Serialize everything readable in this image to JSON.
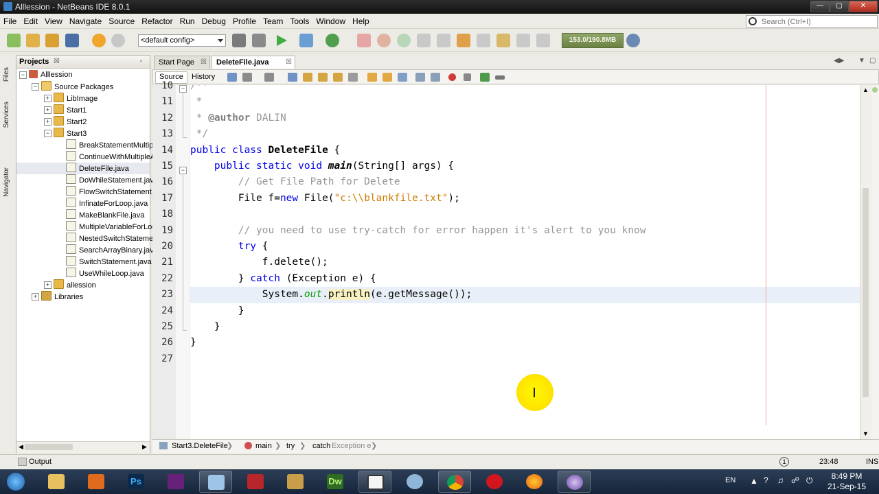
{
  "window": {
    "title": "Alllession - NetBeans IDE 8.0.1"
  },
  "menu": [
    "File",
    "Edit",
    "View",
    "Navigate",
    "Source",
    "Refactor",
    "Run",
    "Debug",
    "Profile",
    "Team",
    "Tools",
    "Window",
    "Help"
  ],
  "search": {
    "placeholder": "Search (Ctrl+I)"
  },
  "toolbar": {
    "config": "<default config>",
    "memory": "153.0/190.8MB"
  },
  "side_tabs": [
    "Files",
    "Services",
    "Navigator"
  ],
  "projects": {
    "title": "Projects",
    "tree": [
      {
        "label": "Alllession",
        "level": 0,
        "type": "proj",
        "exp": "-"
      },
      {
        "label": "Source Packages",
        "level": 1,
        "type": "pkg",
        "exp": "-"
      },
      {
        "label": "LibImage",
        "level": 2,
        "type": "folder",
        "exp": "+"
      },
      {
        "label": "Start1",
        "level": 2,
        "type": "folder",
        "exp": "+"
      },
      {
        "label": "Start2",
        "level": 2,
        "type": "folder",
        "exp": "+"
      },
      {
        "label": "Start3",
        "level": 2,
        "type": "folder",
        "exp": "-"
      },
      {
        "label": "BreakStatementMultipl",
        "level": 3,
        "type": "java"
      },
      {
        "label": "ContinueWithMultipleA",
        "level": 3,
        "type": "java"
      },
      {
        "label": "DeleteFile.java",
        "level": 3,
        "type": "java",
        "selected": true
      },
      {
        "label": "DoWhileStatement.java",
        "level": 3,
        "type": "java"
      },
      {
        "label": "FlowSwitchStatement.",
        "level": 3,
        "type": "java"
      },
      {
        "label": "InfinateForLoop.java",
        "level": 3,
        "type": "java"
      },
      {
        "label": "MakeBlankFile.java",
        "level": 3,
        "type": "java"
      },
      {
        "label": "MultipleVariableForLoo",
        "level": 3,
        "type": "java"
      },
      {
        "label": "NestedSwitchStatemer",
        "level": 3,
        "type": "java"
      },
      {
        "label": "SearchArrayBinary.jav",
        "level": 3,
        "type": "java"
      },
      {
        "label": "SwitchStatement.java",
        "level": 3,
        "type": "java"
      },
      {
        "label": "UseWhileLoop.java",
        "level": 3,
        "type": "java"
      },
      {
        "label": "allession",
        "level": 2,
        "type": "folder",
        "exp": "+"
      },
      {
        "label": "Libraries",
        "level": 1,
        "type": "lib",
        "exp": "+"
      }
    ]
  },
  "editor": {
    "tabs": [
      {
        "label": "Start Page",
        "active": false
      },
      {
        "label": "DeleteFile.java",
        "active": true
      }
    ],
    "source_label": "Source",
    "history_label": "History",
    "current_line": 23,
    "lines": [
      {
        "n": "10",
        "tokens": [
          {
            "t": "/**",
            "c": "cm"
          }
        ]
      },
      {
        "n": "11",
        "tokens": [
          {
            "t": " *",
            "c": "cm"
          }
        ]
      },
      {
        "n": "12",
        "tokens": [
          {
            "t": " * ",
            "c": "cm"
          },
          {
            "t": "@author",
            "c": "at"
          },
          {
            "t": " DALIN",
            "c": "cm"
          }
        ]
      },
      {
        "n": "13",
        "tokens": [
          {
            "t": " */",
            "c": "cm"
          }
        ]
      },
      {
        "n": "14",
        "tokens": [
          {
            "t": "public class ",
            "c": "kw"
          },
          {
            "t": "DeleteFile",
            "c": "b"
          },
          {
            "t": " {",
            "c": ""
          }
        ]
      },
      {
        "n": "15",
        "tokens": [
          {
            "t": "    public static void ",
            "c": "kw"
          },
          {
            "t": "main",
            "c": "mth"
          },
          {
            "t": "(String[] args) {",
            "c": ""
          }
        ]
      },
      {
        "n": "16",
        "tokens": [
          {
            "t": "        // Get File Path for Delete",
            "c": "cm"
          }
        ]
      },
      {
        "n": "17",
        "tokens": [
          {
            "t": "        File f=",
            "c": ""
          },
          {
            "t": "new",
            "c": "kw"
          },
          {
            "t": " File(",
            "c": ""
          },
          {
            "t": "\"c:\\\\blankfile.txt\"",
            "c": "str"
          },
          {
            "t": ");",
            "c": ""
          }
        ]
      },
      {
        "n": "18",
        "tokens": [
          {
            "t": "",
            "c": ""
          }
        ]
      },
      {
        "n": "19",
        "tokens": [
          {
            "t": "        // you need to use try-catch for error happen it's alert to you know",
            "c": "cm"
          }
        ]
      },
      {
        "n": "20",
        "tokens": [
          {
            "t": "        ",
            "c": ""
          },
          {
            "t": "try",
            "c": "kw"
          },
          {
            "t": " {",
            "c": ""
          }
        ]
      },
      {
        "n": "21",
        "tokens": [
          {
            "t": "            f.delete();",
            "c": ""
          }
        ]
      },
      {
        "n": "22",
        "tokens": [
          {
            "t": "        } ",
            "c": ""
          },
          {
            "t": "catch",
            "c": "kw"
          },
          {
            "t": " (Exception e) {",
            "c": ""
          }
        ]
      },
      {
        "n": "23",
        "tokens": [
          {
            "t": "            System.",
            "c": ""
          },
          {
            "t": "out",
            "c": "fld"
          },
          {
            "t": ".",
            "c": ""
          },
          {
            "t": "println",
            "c": "hl"
          },
          {
            "t": "(e.getMessage());",
            "c": ""
          }
        ]
      },
      {
        "n": "24",
        "tokens": [
          {
            "t": "        }",
            "c": ""
          }
        ]
      },
      {
        "n": "25",
        "tokens": [
          {
            "t": "    }",
            "c": ""
          }
        ]
      },
      {
        "n": "26",
        "tokens": [
          {
            "t": "}",
            "c": ""
          }
        ]
      },
      {
        "n": "27",
        "tokens": [
          {
            "t": "",
            "c": ""
          }
        ]
      }
    ]
  },
  "breadcrumb": {
    "class": "Start3.DeleteFile",
    "method": "main",
    "try": "try",
    "catch": "catch",
    "catch_detail": "Exception e"
  },
  "status": {
    "output_label": "Output",
    "position": "23:48",
    "mode": "INS"
  },
  "taskbar": {
    "icons": [
      "start-orb-icon",
      "file-explorer-icon",
      "media-player-icon",
      "photoshop-icon",
      "visual-studio-icon",
      "virtualbox-icon",
      "winrar-icon",
      "tools-icon",
      "dreamweaver-icon",
      "window-icon",
      "network-icon",
      "chrome-icon",
      "opera-icon",
      "firefox-icon",
      "netbeans-icon"
    ],
    "photoshop_label": "Ps",
    "dreamweaver_label": "Dw",
    "language": "EN",
    "time": "8:49 PM",
    "date": "21-Sep-15"
  }
}
